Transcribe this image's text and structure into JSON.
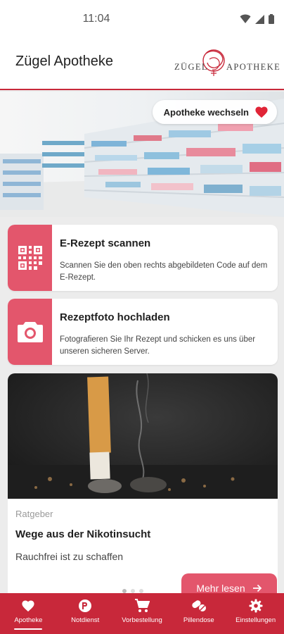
{
  "status": {
    "time": "11:04"
  },
  "header": {
    "title": "Zügel Apotheke",
    "logo_left": "Zügel",
    "logo_right": "Apotheke"
  },
  "hero": {
    "chip_label": "Apotheke wechseln",
    "chip_icon": "heart-icon"
  },
  "cards": [
    {
      "title": "E-Rezept scannen",
      "desc": "Scannen Sie den oben rechts abgebildeten Code auf dem E-Rezept.",
      "icon": "qr-code-icon"
    },
    {
      "title": "Rezeptfoto hochladen",
      "desc": "Fotografieren Sie Ihr Rezept und schicken es uns über unseren sicheren Server.",
      "icon": "camera-icon"
    }
  ],
  "article": {
    "category": "Ratgeber",
    "title": "Wege aus der Nikotinsucht",
    "subtitle": "Rauchfrei ist zu schaffen",
    "more_label": "Mehr lesen"
  },
  "nav": [
    {
      "label": "Apotheke",
      "icon": "heart-icon",
      "active": true
    },
    {
      "label": "Notdienst",
      "icon": "pharmacy-badge-icon",
      "active": false
    },
    {
      "label": "Vorbestellung",
      "icon": "cart-icon",
      "active": false
    },
    {
      "label": "Pillendose",
      "icon": "pills-icon",
      "active": false
    },
    {
      "label": "Einstellungen",
      "icon": "gear-icon",
      "active": false
    }
  ],
  "colors": {
    "accent": "#c8283a",
    "card_accent": "#e3566c"
  }
}
